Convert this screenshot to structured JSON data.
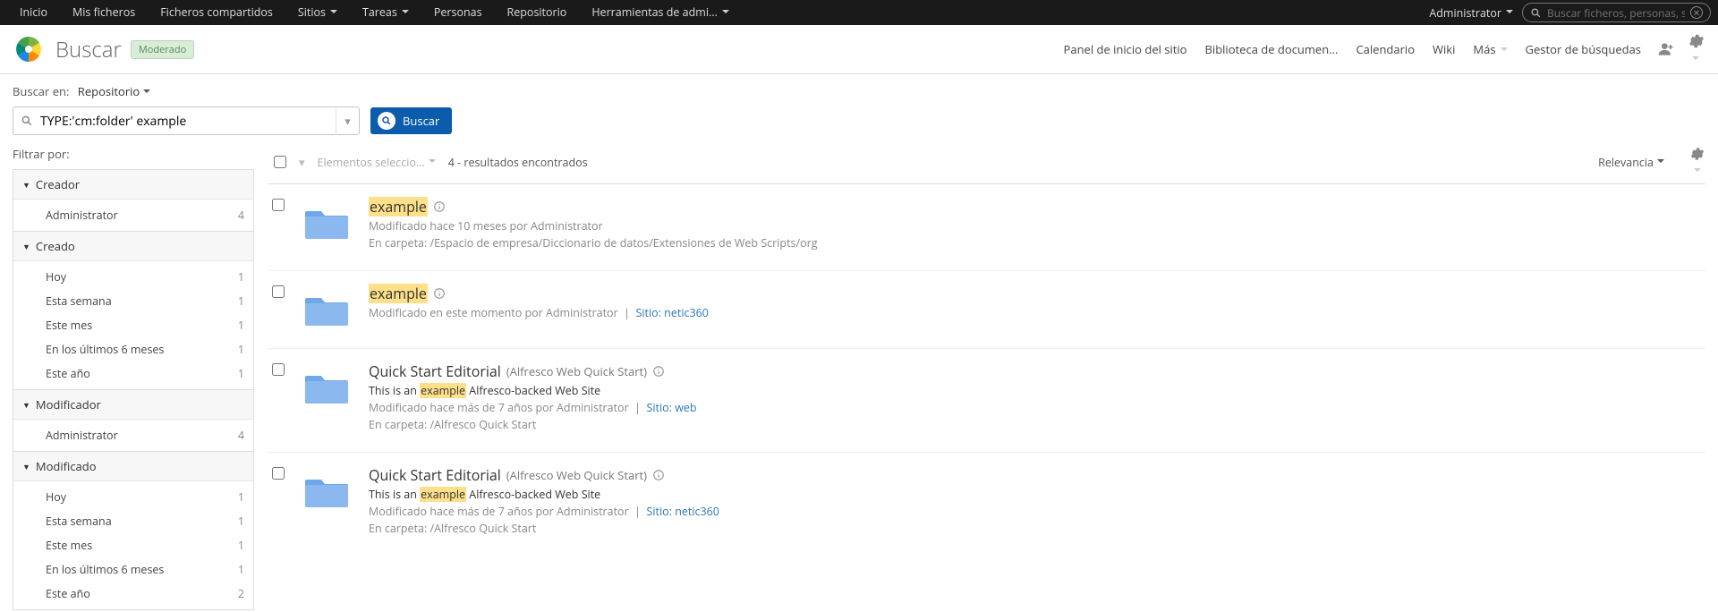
{
  "topbar": {
    "items": [
      "Inicio",
      "Mis ficheros",
      "Ficheros compartidos",
      "Sitios",
      "Tareas",
      "Personas",
      "Repositorio",
      "Herramientas de admi..."
    ],
    "dropdown_indices": [
      3,
      4,
      7
    ],
    "user": "Administrator",
    "search_placeholder": "Buscar ficheros, personas, siti"
  },
  "header": {
    "title": "Buscar",
    "badge": "Moderado",
    "sitenav": [
      "Panel de inicio del sitio",
      "Biblioteca de documen...",
      "Calendario",
      "Wiki",
      "Más",
      "Gestor de búsquedas"
    ],
    "sitenav_dropdown_indices": [
      4
    ]
  },
  "search": {
    "scope_label": "Buscar en:",
    "scope_value": "Repositorio",
    "query": "TYPE:'cm:folder' example",
    "button": "Buscar"
  },
  "filters": {
    "title": "Filtrar por:",
    "facets": [
      {
        "name": "Creador",
        "items": [
          {
            "label": "Administrator",
            "count": 4
          }
        ]
      },
      {
        "name": "Creado",
        "items": [
          {
            "label": "Hoy",
            "count": 1
          },
          {
            "label": "Esta semana",
            "count": 1
          },
          {
            "label": "Este mes",
            "count": 1
          },
          {
            "label": "En los últimos 6 meses",
            "count": 1
          },
          {
            "label": "Este año",
            "count": 1
          }
        ]
      },
      {
        "name": "Modificador",
        "items": [
          {
            "label": "Administrator",
            "count": 4
          }
        ]
      },
      {
        "name": "Modificado",
        "items": [
          {
            "label": "Hoy",
            "count": 1
          },
          {
            "label": "Esta semana",
            "count": 1
          },
          {
            "label": "Este mes",
            "count": 1
          },
          {
            "label": "En los últimos 6 meses",
            "count": 1
          },
          {
            "label": "Este año",
            "count": 2
          }
        ]
      }
    ]
  },
  "resultbar": {
    "selected": "Elementos seleccio...",
    "count_text": "4 - resultados encontrados",
    "sort": "Relevancia"
  },
  "results": [
    {
      "title_hl": "example",
      "title_plain": "",
      "subtitle": "",
      "snippet": "",
      "modified": "Modificado hace 10 meses por Administrator",
      "site": "",
      "path_label": "En carpeta: ",
      "path": "/Espacio de empresa/Diccionario de datos/Extensiones de Web Scripts/org"
    },
    {
      "title_hl": "example",
      "title_plain": "",
      "subtitle": "",
      "snippet": "",
      "modified": "Modificado en este momento por Administrator",
      "site": "Sitio: netic360",
      "path_label": "",
      "path": ""
    },
    {
      "title_hl": "",
      "title_plain": "Quick Start Editorial",
      "subtitle": "(Alfresco Web Quick Start)",
      "snippet_pre": "This is an ",
      "snippet_hl": "example",
      "snippet_post": " Alfresco-backed Web Site",
      "modified": "Modificado hace más de 7 años por Administrator",
      "site": "Sitio: web",
      "path_label": "En carpeta: ",
      "path": "/Alfresco Quick Start"
    },
    {
      "title_hl": "",
      "title_plain": "Quick Start Editorial",
      "subtitle": "(Alfresco Web Quick Start)",
      "snippet_pre": "This is an ",
      "snippet_hl": "example",
      "snippet_post": " Alfresco-backed Web Site",
      "modified": "Modificado hace más de 7 años por Administrator",
      "site": "Sitio: netic360",
      "path_label": "En carpeta: ",
      "path": "/Alfresco Quick Start"
    }
  ]
}
